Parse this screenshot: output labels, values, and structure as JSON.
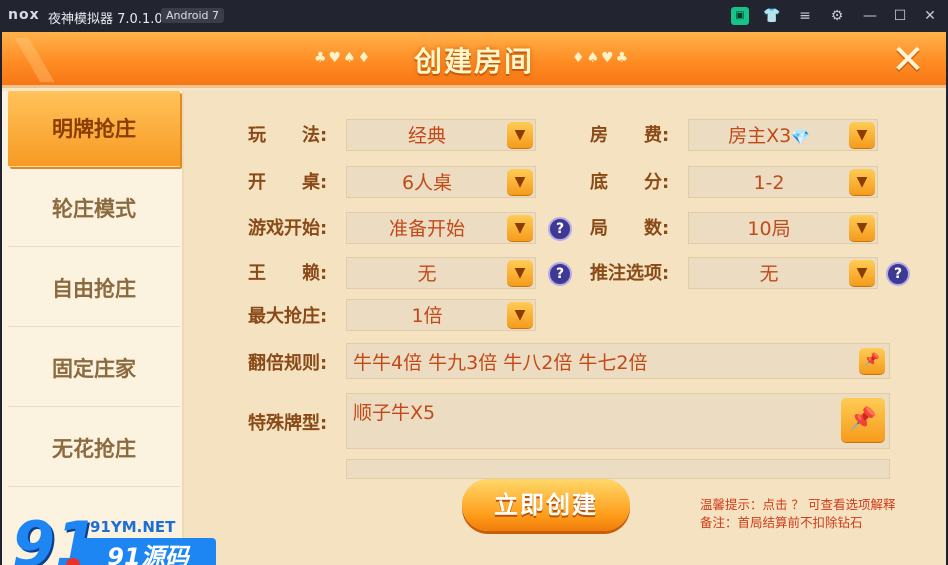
{
  "titlebar": {
    "logo": "nox",
    "title": "夜神模拟器 7.0.1.0",
    "badge": "Android 7"
  },
  "header": {
    "title": "创建房间",
    "suits_left": "♣♥♠♦",
    "suits_right": "♦♠♥♣"
  },
  "sidebar": {
    "items": [
      {
        "label": "明牌抢庄"
      },
      {
        "label": "轮庄模式"
      },
      {
        "label": "自由抢庄"
      },
      {
        "label": "固定庄家"
      },
      {
        "label": "无花抢庄"
      }
    ]
  },
  "form": {
    "play": {
      "label": "玩　　法:",
      "value": "经典"
    },
    "fee": {
      "label": "房　　费:",
      "value": "房主X3",
      "icon": "diamond-icon"
    },
    "seats": {
      "label": "开　　桌:",
      "value": "6人桌"
    },
    "base": {
      "label": "底　　分:",
      "value": "1-2"
    },
    "start": {
      "label": "游戏开始:",
      "value": "准备开始"
    },
    "rounds": {
      "label": "局　　数:",
      "value": "10局"
    },
    "wild": {
      "label": "王　　赖:",
      "value": "无"
    },
    "bet": {
      "label": "推注选项:",
      "value": "无"
    },
    "maxbank": {
      "label": "最大抢庄:",
      "value": "1倍"
    },
    "multiplier": {
      "label": "翻倍规则:",
      "value": "牛牛4倍 牛九3倍 牛八2倍 牛七2倍"
    },
    "special": {
      "label": "特殊牌型:",
      "value": "顺子牛X5"
    }
  },
  "create_button": "立即创建",
  "tips": {
    "line1": "温馨提示：点击 ？ 可查看选项解释",
    "line2": "备注：首局结算前不扣除钻石"
  },
  "watermark": {
    "number": "91",
    "url": "91YM.NET",
    "brand": "91源码"
  },
  "colors": {
    "accent": "#f79a24",
    "label": "#8a4a17",
    "value": "#c24a1a",
    "background": "#f4e2c1"
  }
}
